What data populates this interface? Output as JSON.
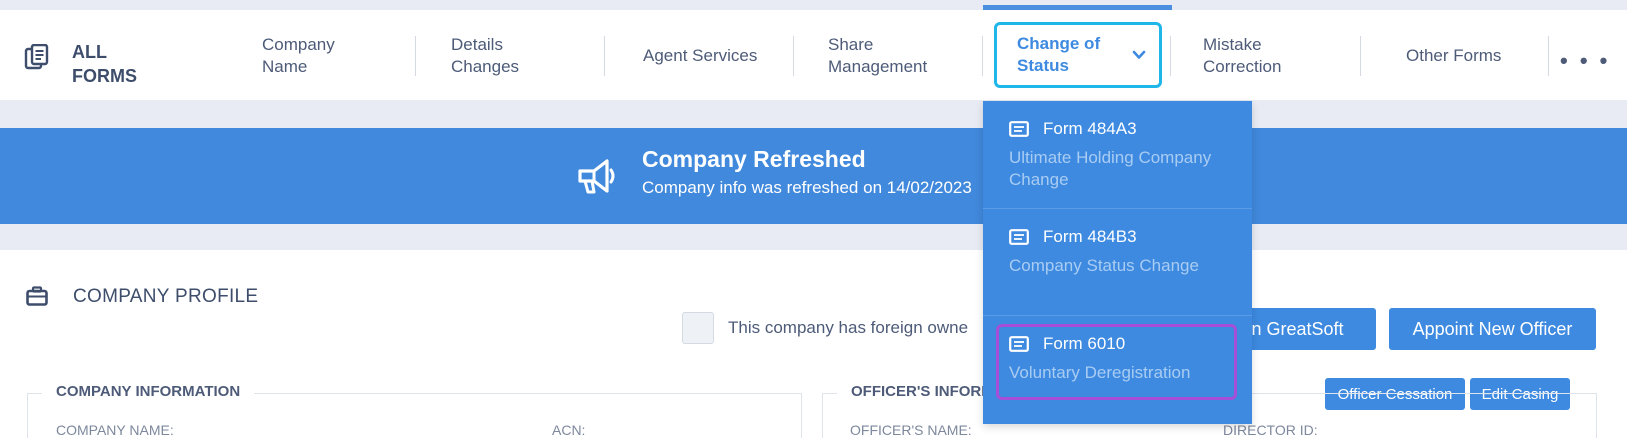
{
  "brand": {
    "label": "ALL FORMS"
  },
  "nav": {
    "items": [
      {
        "label": "Company Name"
      },
      {
        "label": "Details Changes"
      },
      {
        "label": "Agent Services"
      },
      {
        "label": "Share Management"
      },
      {
        "label": "Change of Status"
      },
      {
        "label": "Mistake Correction"
      },
      {
        "label": "Other Forms"
      }
    ],
    "more": "• • •"
  },
  "banner": {
    "title": "Company Refreshed",
    "subtitle": "Company info was refreshed on 14/02/2023"
  },
  "profile": {
    "title": "COMPANY PROFILE",
    "foreign_text": "This company has foreign owne",
    "buttons": {
      "greatsoft": "n in GreatSoft",
      "appoint": "Appoint New Officer",
      "cessation": "Officer Cessation",
      "casing": "Edit Casing"
    },
    "company_info": {
      "legend": "COMPANY INFORMATION",
      "company_name_label": "COMPANY NAME:",
      "acn_label": "ACN:"
    },
    "officer_info": {
      "legend": "OFFICER'S INFORI",
      "officer_name_label": "OFFICER'S NAME:",
      "director_id_label": "DIRECTOR ID:"
    }
  },
  "dropdown": {
    "items": [
      {
        "form": "Form 484A3",
        "description": "Ultimate Holding Company Change"
      },
      {
        "form": "Form 484B3",
        "description": "Company Status Change"
      },
      {
        "form": "Form 6010",
        "description": "Voluntary Deregistration"
      }
    ]
  },
  "colors": {
    "accent": "#3d8ae0",
    "banner": "#4189dc",
    "active_border": "#1fb6e9",
    "highlight_border": "#a64ed8"
  }
}
